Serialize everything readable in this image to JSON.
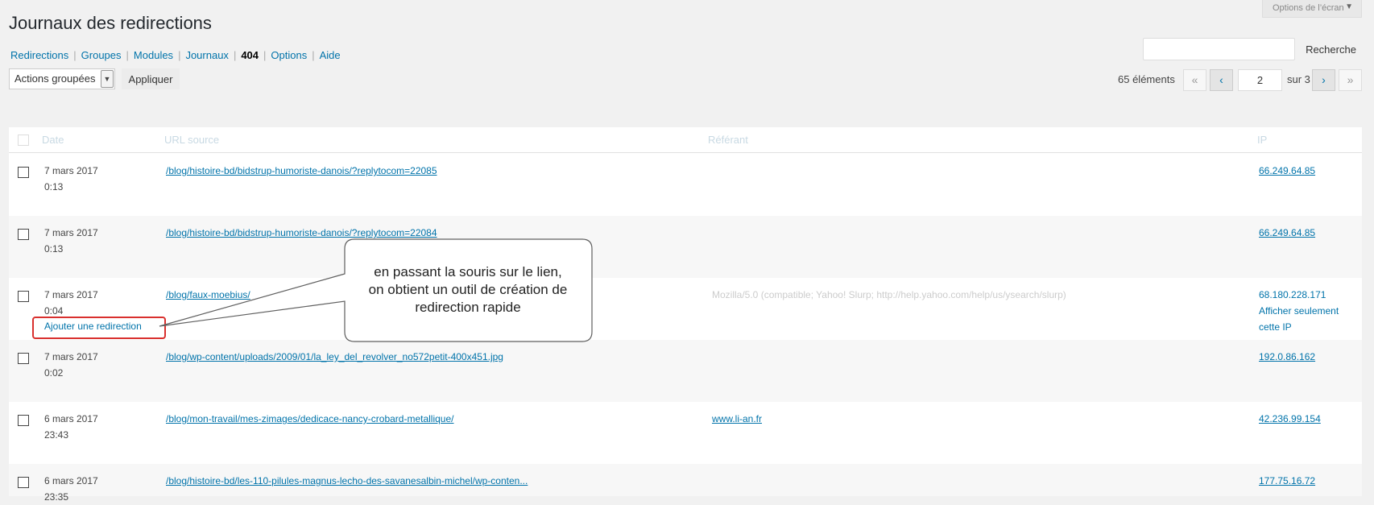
{
  "screen_options": {
    "label": "Options de l’écran"
  },
  "page_title": "Journaux des redirections",
  "nav": {
    "items": [
      {
        "label": "Redirections",
        "current": false
      },
      {
        "label": "Groupes",
        "current": false
      },
      {
        "label": "Modules",
        "current": false
      },
      {
        "label": "Journaux",
        "current": false
      },
      {
        "label": "404",
        "current": true
      },
      {
        "label": "Options",
        "current": false
      },
      {
        "label": "Aide",
        "current": false
      }
    ],
    "separator": "|"
  },
  "search": {
    "value": "",
    "button_label": "Recherche"
  },
  "bulk": {
    "selected": "Actions groupées",
    "apply_label": "Appliquer"
  },
  "pagination": {
    "items_count": "65 éléments",
    "first": "«",
    "prev": "‹",
    "current_page": "2",
    "of_label": "sur 3",
    "next": "›",
    "last": "»"
  },
  "table": {
    "headers": {
      "date": "Date",
      "source": "URL source",
      "referrer": "Référant",
      "ip": "IP"
    },
    "rows": [
      {
        "date": "7 mars 2017",
        "time": "0:13",
        "source": "/blog/histoire-bd/bidstrup-humoriste-danois/?replytocom=22085",
        "referrer": "",
        "ip": "66.249.64.85"
      },
      {
        "date": "7 mars 2017",
        "time": "0:13",
        "source": "/blog/histoire-bd/bidstrup-humoriste-danois/?replytocom=22084",
        "referrer": "",
        "ip": "66.249.64.85"
      },
      {
        "date": "7 mars 2017",
        "time": "0:04",
        "source": "/blog/faux-moebius/",
        "referrer": "Mozilla/5.0 (compatible; Yahoo! Slurp; http://help.yahoo.com/help/us/ysearch/slurp)",
        "ip": "68.180.228.171",
        "row_action": "Ajouter une redirection",
        "ip_action_1": "Afficher seulement",
        "ip_action_2": "cette IP"
      },
      {
        "date": "7 mars 2017",
        "time": "0:02",
        "source": "/blog/wp-content/uploads/2009/01/la_ley_del_revolver_no572petit-400x451.jpg",
        "referrer": "",
        "ip": "192.0.86.162"
      },
      {
        "date": "6 mars 2017",
        "time": "23:43",
        "source": "/blog/mon-travail/mes-zimages/dedicace-nancy-crobard-metallique/",
        "referrer": "www.li-an.fr",
        "ip": "42.236.99.154"
      },
      {
        "date": "6 mars 2017",
        "time": "23:35",
        "source": "/blog/histoire-bd/les-110-pilules-magnus-lecho-des-savanesalbin-michel/wp-conten...",
        "referrer": "",
        "ip": "177.75.16.72"
      }
    ]
  },
  "callout": {
    "lines": [
      "en passant la souris sur le lien,",
      "on obtient un outil de création de",
      "redirection rapide"
    ]
  }
}
